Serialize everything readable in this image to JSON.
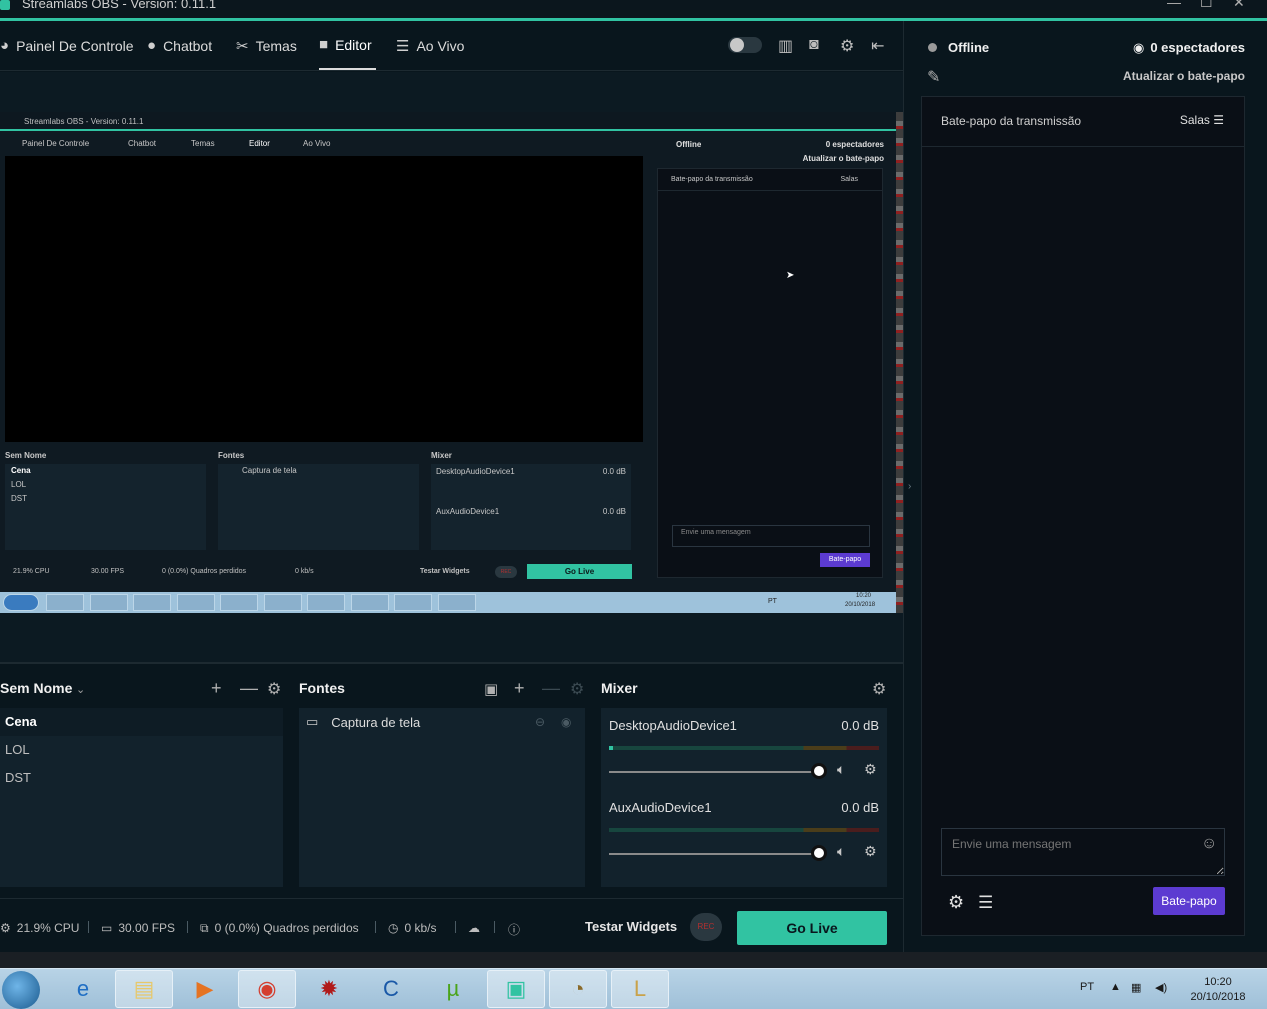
{
  "window": {
    "title": "Streamlabs OBS - Version: 0.11.1",
    "controls": [
      "—",
      "☐",
      "✕"
    ]
  },
  "nav": {
    "items": [
      {
        "label": "Painel De Controle",
        "icon": "dashboard-icon"
      },
      {
        "label": "Chatbot",
        "icon": "chat-bubble-icon"
      },
      {
        "label": "Temas",
        "icon": "tools-icon"
      },
      {
        "label": "Editor",
        "icon": "camera-icon",
        "active": true
      },
      {
        "label": "Ao Vivo",
        "icon": "live-list-icon"
      }
    ]
  },
  "nested_preview": {
    "title": "Streamlabs OBS - Version: 0.11.1",
    "nav": [
      "Painel De Controle",
      "Chatbot",
      "Temas",
      "Editor",
      "Ao Vivo"
    ],
    "status": "Offline",
    "viewers": "0 espectadores",
    "refresh": "Atualizar o bate-papo",
    "chat_title": "Bate-papo da transmissão",
    "rooms": "Salas",
    "chat_placeholder": "Envie uma mensagem",
    "chat_button": "Bate-papo",
    "scene_header": "Sem Nome",
    "sources_header": "Fontes",
    "mixer_header": "Mixer",
    "scenes": [
      "Cena",
      "LOL",
      "DST"
    ],
    "source": "Captura de tela",
    "dev1": "DesktopAudioDevice1",
    "dev2": "AuxAudioDevice1",
    "db": "0.0 dB",
    "cpu": "21.9% CPU",
    "fps": "30.00 FPS",
    "dropped": "0 (0.0%) Quadros perdidos",
    "kbs": "0 kb/s",
    "testar": "Testar Widgets",
    "rec": "REC",
    "golive": "Go Live",
    "clock_time": "10:20",
    "clock_date": "20/10/2018",
    "lang": "PT"
  },
  "scenes": {
    "header": "Sem Nome",
    "items": [
      "Cena",
      "LOL",
      "DST"
    ]
  },
  "sources": {
    "header": "Fontes",
    "items": [
      "Captura de tela"
    ]
  },
  "mixer": {
    "header": "Mixer",
    "devices": [
      {
        "name": "DesktopAudioDevice1",
        "level": "0.0 dB",
        "volume": 1.0,
        "meter": 0.01
      },
      {
        "name": "AuxAudioDevice1",
        "level": "0.0 dB",
        "volume": 1.0,
        "meter": 0.0
      }
    ]
  },
  "status": {
    "cpu": "21.9% CPU",
    "fps": "30.00 FPS",
    "dropped": "0 (0.0%) Quadros perdidos",
    "bitrate": "0 kb/s",
    "testar": "Testar Widgets",
    "rec": "REC",
    "golive": "Go Live"
  },
  "sidebar": {
    "status": "Offline",
    "viewers": "0 espectadores",
    "refresh": "Atualizar o bate-papo",
    "chat_title": "Bate-papo da transmissão",
    "rooms": "Salas",
    "chat_placeholder": "Envie uma mensagem",
    "chat_button": "Bate-papo"
  },
  "taskbar": {
    "lang": "PT",
    "time": "10:20",
    "date": "20/10/2018",
    "apps": [
      "windows-start-icon",
      "internet-explorer-icon",
      "file-explorer-icon",
      "media-player-icon",
      "chrome-icon",
      "app-red-icon",
      "ccleaner-icon",
      "utorrent-icon",
      "streamlabs-icon",
      "league-client-icon",
      "league-of-legends-icon"
    ]
  },
  "colors": {
    "accent": "#31c3a2",
    "chat_button": "#5c3bd1",
    "background": "#09161d"
  }
}
